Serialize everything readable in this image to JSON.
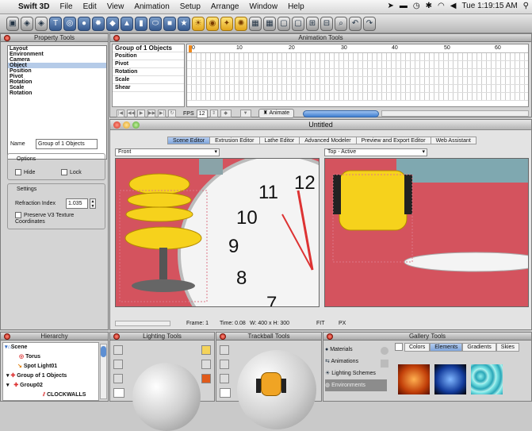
{
  "menubar": {
    "app": "Swift 3D",
    "items": [
      "File",
      "Edit",
      "View",
      "Animation",
      "Setup",
      "Arrange",
      "Window",
      "Help"
    ],
    "clock": "Tue 1:19:15 AM"
  },
  "property_tools": {
    "title": "Property Tools",
    "list": [
      "Layout",
      "Environment",
      "Camera",
      "Object",
      "Position",
      "Pivot",
      "Rotation",
      "Scale",
      "Rotation"
    ],
    "selected_index": 3,
    "name_label": "Name",
    "name_value": "Group of 1 Objects",
    "options_label": "Options",
    "hide_label": "Hide",
    "lock_label": "Lock",
    "settings_label": "Settings",
    "refraction_label": "Refraction Index",
    "refraction_value": "1.035",
    "preserve_label": "Preserve V3 Texture Coordinates"
  },
  "animation_tools": {
    "title": "Animation Tools",
    "header": "Group of 1 Objects",
    "tracks": [
      "Position",
      "Pivot",
      "Rotation",
      "Scale",
      "Shear"
    ],
    "ruler": [
      "0",
      "10",
      "20",
      "30",
      "40",
      "50",
      "60"
    ],
    "fps_label": "FPS",
    "fps_value": "12",
    "animate_label": "Animate"
  },
  "editor": {
    "title": "Untitled",
    "tabs": [
      "Scene Editor",
      "Extrusion Editor",
      "Lathe Editor",
      "Advanced Modeler",
      "Preview and Export Editor",
      "Web Assistant"
    ],
    "active_tab": 0,
    "left_view": "Front",
    "right_view": "Top - Active",
    "clock_numbers": [
      "12",
      "11",
      "10",
      "9",
      "8",
      "7"
    ],
    "status": {
      "frame": "Frame: 1",
      "time": "Time: 0.08",
      "size": "W: 400 x H: 300",
      "fit": "FIT",
      "px": "PX"
    }
  },
  "hierarchy": {
    "title": "Hierarchy",
    "items": [
      "Scene",
      "Torus",
      "Spot Light01",
      "Group of 1 Objects",
      "Group02",
      "CLOCKWALLS"
    ]
  },
  "lighting_tools": {
    "title": "Lighting Tools"
  },
  "trackball_tools": {
    "title": "Trackball Tools"
  },
  "gallery": {
    "title": "Gallery Tools",
    "categories": [
      "Materials",
      "Animations",
      "Lighting Schemes",
      "Environments"
    ],
    "tabs": [
      "Colors",
      "Elements",
      "Gradients",
      "Skies"
    ],
    "active_tab": 1
  },
  "colors": {
    "accent": "#d4535e",
    "chair": "#f6d21c",
    "selection": "#b5cbe8"
  }
}
